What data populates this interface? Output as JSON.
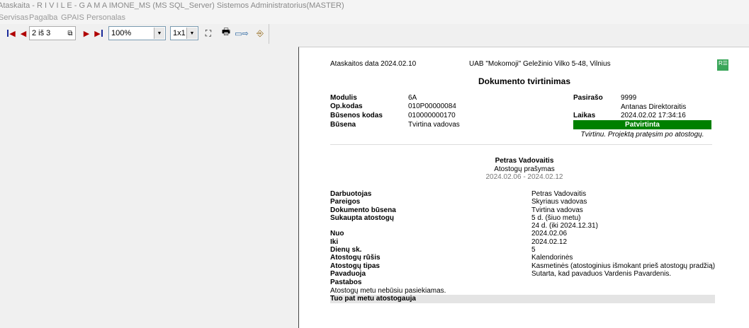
{
  "window": {
    "title": "Ataskaita - R I V I L E - G A M A  IMONE_MS (MS SQL_Server)   Sistemos Administratorius(MASTER)"
  },
  "menu": [
    "Servisas",
    "Pagalba",
    "GPAIS",
    "Personalas"
  ],
  "toolbar": {
    "page_indicator": "2 iš 3",
    "zoom": "100%",
    "layout": "1x1",
    "icons": [
      "first-page-icon",
      "prev-page-icon",
      "copy-icon",
      "next-page-icon",
      "last-page-icon",
      "find-icon",
      "print-icon",
      "export-icon",
      "exit-icon"
    ]
  },
  "report": {
    "header_date": "Ataskaitos data  2024.02.10",
    "company": "UAB \"Mokomoji\"   Geležinio Vilko 5-48, Vilnius",
    "title": "Dokumento tvirtinimas",
    "info": [
      {
        "label": "Modulis",
        "value": "6A"
      },
      {
        "label": "Op.kodas",
        "value": "010P00000084"
      },
      {
        "label": "Būsenos kodas",
        "value": "010000000170"
      },
      {
        "label": "Būsena",
        "value": "Tvirtina vadovas"
      }
    ],
    "sign": {
      "label_signer": "Pasirašo",
      "signer_code": "9999",
      "signer_name": "Antanas Direktoraitis",
      "label_time": "Laikas",
      "time": "2024.02.02 17:34:16",
      "status": "Patvirtinta",
      "status_color": "#008000",
      "comment": "Tvirtinu. Projektą pratęsim po atostogų."
    },
    "person": "Petras Vadovaitis",
    "doc_type": "Atostogų prašymas",
    "period": "2024.02.06 - 2024.02.12",
    "details": [
      {
        "label": "Darbuotojas",
        "value": "Petras Vadovaitis"
      },
      {
        "label": "Pareigos",
        "value": "Skyriaus vadovas"
      },
      {
        "label": "Dokumento būsena",
        "value": "Tvirtina vadovas"
      },
      {
        "label": "Sukaupta atostogų",
        "value": "5 d. (šiuo metu)"
      },
      {
        "label": "",
        "value": "24 d. (iki 2024.12.31)"
      },
      {
        "label": "Nuo",
        "value": "2024.02.06"
      },
      {
        "label": "Iki",
        "value": "2024.02.12"
      },
      {
        "label": "Dienų sk.",
        "value": "5"
      },
      {
        "label": "Atostogų rūšis",
        "value": "Kalendorinės"
      },
      {
        "label": "Atostogų tipas",
        "value": "Kasmetinės (atostoginius išmokant prieš atostogų pradžią)"
      },
      {
        "label": "Pavaduoja",
        "value": "Sutarta, kad pavaduos Vardenis Pavardenis."
      },
      {
        "label": "Pastabos",
        "value": ""
      }
    ],
    "notes": "Atostogų metu nebūsiu pasiekiamas.",
    "concurrent_label": "Tuo pat metu atostogauja"
  }
}
